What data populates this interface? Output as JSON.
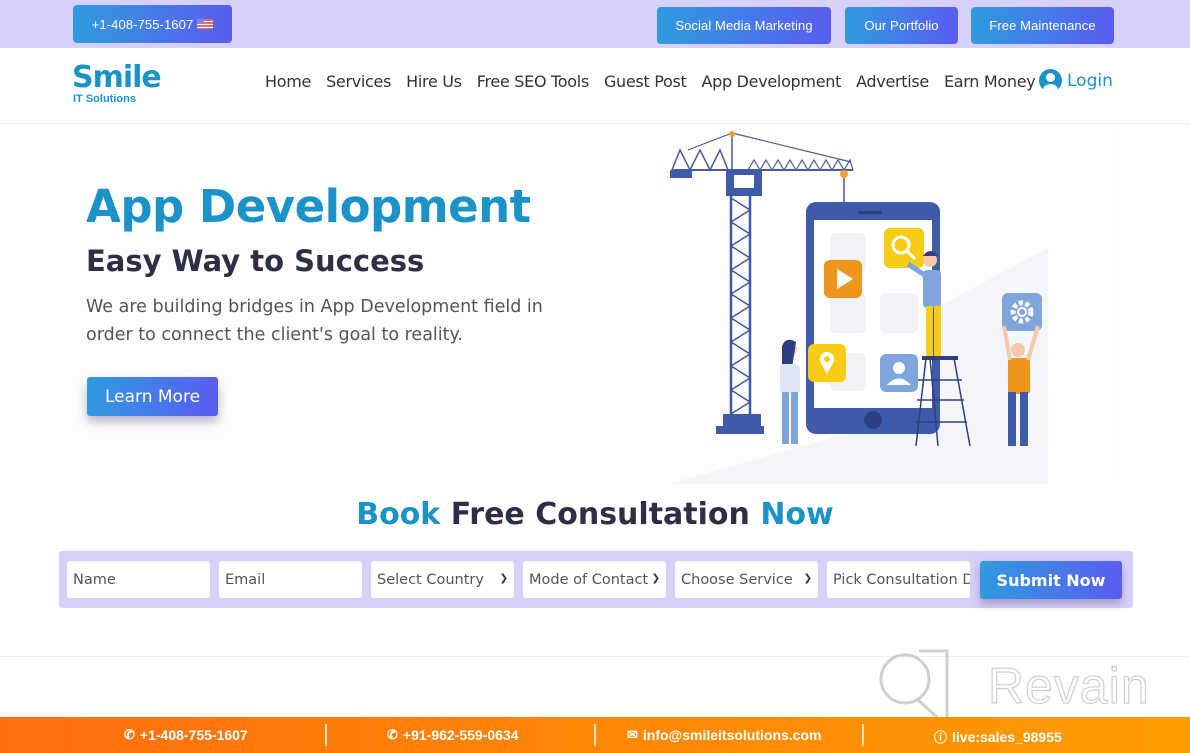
{
  "topbar": {
    "phone": "+1-408-755-1607",
    "flag": "us-flag-icon",
    "buttons": [
      "Social Media Marketing",
      "Our Portfolio",
      "Free Maintenance"
    ]
  },
  "logo": {
    "word": "Smile",
    "sub": "IT Solutions"
  },
  "nav": {
    "items": [
      "Home",
      "Services",
      "Hire Us",
      "Free SEO Tools",
      "Guest Post",
      "App Development",
      "Advertise",
      "Earn Money"
    ],
    "login": "Login"
  },
  "hero": {
    "title": "App Development",
    "subtitle": "Easy Way to Success",
    "description": "We are building bridges in App Development field in order to connect the client's goal to reality.",
    "cta": "Learn More"
  },
  "booking": {
    "title_part1": "Book",
    "title_part2": " Free Consultation ",
    "title_part3": "Now",
    "fields": {
      "name": "Name",
      "email": "Email",
      "country": "Select Country",
      "mode": "Mode of Contact",
      "service": "Choose Service",
      "date": "Pick Consultation Date"
    },
    "submit": "Submit Now"
  },
  "watermark": "Revain",
  "footer": {
    "phone1": "+1-408-755-1607",
    "phone2": "+91-962-559-0634",
    "email": "info@smileitsolutions.com",
    "skype": "live:sales_98955"
  },
  "colors": {
    "accent": "#1b93c8",
    "topbar_bg": "#d6d0fb",
    "button_grad_start": "#2f9be0",
    "button_grad_end": "#5a5cf0",
    "footer_start": "#ff6f0e",
    "footer_end": "#ff9d00",
    "heading_dark": "#2e2e45"
  }
}
